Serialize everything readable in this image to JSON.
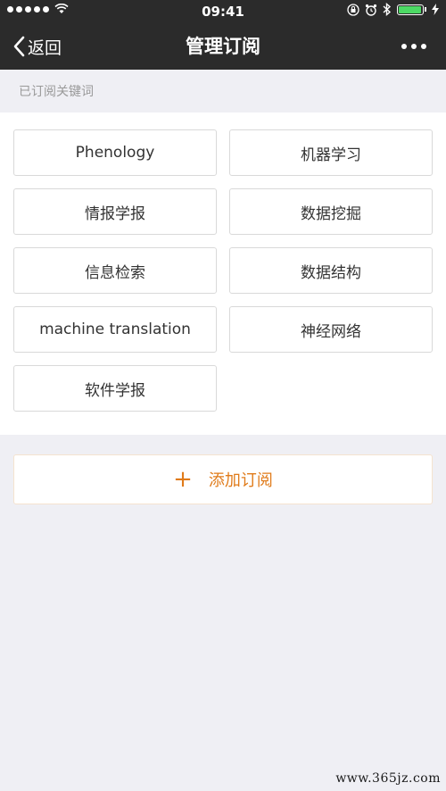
{
  "status_bar": {
    "time": "09:41",
    "battery_level": 0.9,
    "battery_color": "#4cd964"
  },
  "nav": {
    "back_label": "返回",
    "title": "管理订阅",
    "back_icon": "chevron-left-icon",
    "more_icon": "more-dots-icon"
  },
  "section": {
    "label": "已订阅关键词"
  },
  "keywords": [
    {
      "label": "Phenology"
    },
    {
      "label": "机器学习"
    },
    {
      "label": "情报学报"
    },
    {
      "label": "数据挖掘"
    },
    {
      "label": "信息检索"
    },
    {
      "label": "数据结构"
    },
    {
      "label": "machine translation"
    },
    {
      "label": "神经网络"
    },
    {
      "label": "软件学报"
    }
  ],
  "add_subscription": {
    "icon": "plus-icon",
    "label": "添加订阅",
    "color": "#e07b1a"
  },
  "watermark": "www.365jz.com"
}
